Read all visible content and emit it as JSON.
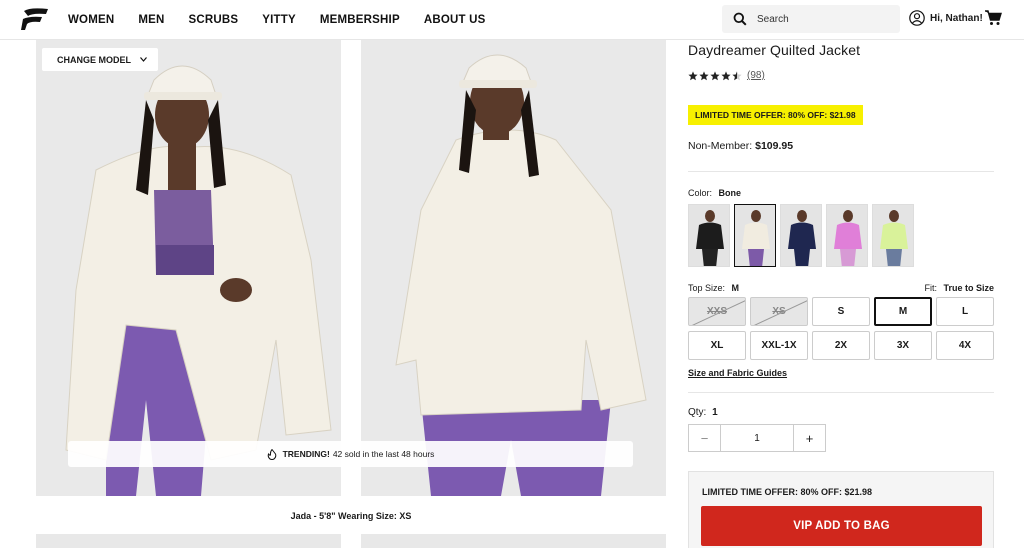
{
  "header": {
    "nav": [
      "WOMEN",
      "MEN",
      "SCRUBS",
      "YITTY",
      "MEMBERSHIP",
      "ABOUT US"
    ],
    "search_placeholder": "Search",
    "greeting": "Hi, Nathan!"
  },
  "gallery": {
    "change_model": "CHANGE MODEL",
    "trending_label": "TRENDING!",
    "trending_text": "42 sold in the last 48 hours",
    "caption": "Jada - 5'8\" Wearing Size: XS"
  },
  "product": {
    "title": "Daydreamer Quilted Jacket",
    "rating": 4.5,
    "review_count": "(98)",
    "offer_badge": "LIMITED TIME OFFER: 80% OFF:  $21.98",
    "nonmember_label": "Non-Member:",
    "nonmember_price": "$109.95",
    "color_label": "Color:",
    "color_value": "Bone",
    "swatches": [
      {
        "name": "Black",
        "jacket": "#1c1c1c",
        "pants": "#222222",
        "selected": false
      },
      {
        "name": "Bone",
        "jacket": "#f1ece0",
        "pants": "#7d5aa8",
        "selected": true
      },
      {
        "name": "Navy",
        "jacket": "#1f2750",
        "pants": "#1f2750",
        "selected": false
      },
      {
        "name": "Pink",
        "jacket": "#e07fd8",
        "pants": "#d79ad5",
        "selected": false
      },
      {
        "name": "Lime",
        "jacket": "#d9f29a",
        "pants": "#6a7c9e",
        "selected": false
      }
    ],
    "top_size_label": "Top Size:",
    "top_size_value": "M",
    "fit_label": "Fit:",
    "fit_value": "True to Size",
    "sizes": [
      {
        "label": "XXS",
        "state": "unavailable"
      },
      {
        "label": "XS",
        "state": "unavailable"
      },
      {
        "label": "S",
        "state": "available"
      },
      {
        "label": "M",
        "state": "selected"
      },
      {
        "label": "L",
        "state": "available"
      },
      {
        "label": "XL",
        "state": "available"
      },
      {
        "label": "XXL-1X",
        "state": "available"
      },
      {
        "label": "2X",
        "state": "available"
      },
      {
        "label": "3X",
        "state": "available"
      },
      {
        "label": "4X",
        "state": "available"
      }
    ],
    "guides_link": "Size and Fabric Guides",
    "qty_label": "Qty:",
    "qty_value": "1",
    "qty_minus": "−",
    "qty_plus": "+",
    "box_offer": "LIMITED TIME OFFER: 80% OFF: $21.98",
    "add_to_bag": "VIP ADD TO BAG"
  },
  "colors": {
    "accent_red": "#d0271d",
    "offer_yellow": "#f7f000"
  }
}
